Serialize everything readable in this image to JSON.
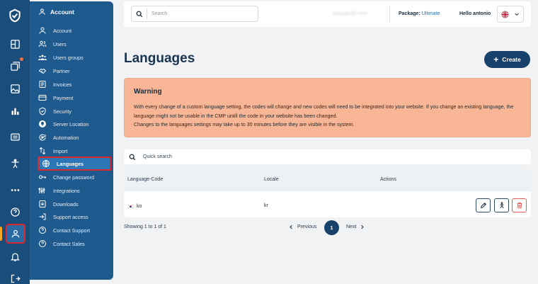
{
  "sidebar": {
    "header": "Account",
    "items": [
      {
        "label": "Account",
        "icon": "user-icon"
      },
      {
        "label": "Users",
        "icon": "users-icon"
      },
      {
        "label": "Users groups",
        "icon": "user-groups-icon"
      },
      {
        "label": "Partner",
        "icon": "handshake-icon"
      },
      {
        "label": "Invoices",
        "icon": "invoice-icon"
      },
      {
        "label": "Payment",
        "icon": "credit-card-icon"
      },
      {
        "label": "Security",
        "icon": "shield-icon"
      },
      {
        "label": "Server Location",
        "icon": "globe-pin-icon"
      },
      {
        "label": "Automation",
        "icon": "automation-icon"
      },
      {
        "label": "Import",
        "icon": "import-icon"
      },
      {
        "label": "Languages",
        "icon": "globe-icon"
      },
      {
        "label": "Change password",
        "icon": "key-icon"
      },
      {
        "label": "Integrations",
        "icon": "integrations-icon"
      },
      {
        "label": "Downloads",
        "icon": "download-icon"
      },
      {
        "label": "Support access",
        "icon": "login-icon"
      },
      {
        "label": "Contact Support",
        "icon": "help-circle-icon"
      },
      {
        "label": "Contact Sales",
        "icon": "help-circle-icon"
      }
    ],
    "active": "Languages"
  },
  "topbar": {
    "search_placeholder": "Search",
    "account_id": "Account ID: ••••••",
    "package_label": "Package:",
    "package_value": "Ultimate",
    "greeting": "Hello antonio",
    "language_flag": "uk-flag-icon"
  },
  "page": {
    "title": "Languages",
    "create_label": "Create"
  },
  "warning": {
    "title": "Warning",
    "line1": "With every change of a custom language setting, the codes will change and new codes will need to be integrated into your website. If you change an existing language, the language might not be usable in the CMP untill the code in your website has been changed.",
    "line2": "Changes to the languages settings may take up to 30 minutes before they are visible in the system.",
    "color": "#f8b696"
  },
  "quick_search": {
    "placeholder": "Quick search"
  },
  "table": {
    "columns": [
      "Language-Code",
      "Locale",
      "Actions"
    ],
    "rows": [
      {
        "language_code": "ko",
        "flag": "kr-flag-icon",
        "locale": "kr"
      }
    ]
  },
  "pagination": {
    "showing": "Showing 1 to 1 of 1",
    "prev": "Previous",
    "current": "1",
    "next": "Next"
  },
  "colors": {
    "sidebar": "#1e5a8e",
    "rail": "#1b4d7b",
    "primary_button": "#17406a",
    "highlight": "#d9262c"
  }
}
